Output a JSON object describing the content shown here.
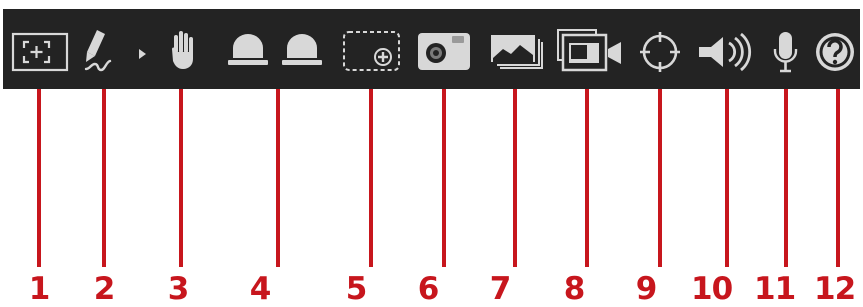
{
  "toolbar": {
    "background": "#232323",
    "icon_color": "#d8d8d8",
    "tools": [
      {
        "number": "1",
        "icon": "fullscreen-crosshair-icon"
      },
      {
        "number": "2",
        "icon": "pen-draw-icon",
        "has_dropdown": true
      },
      {
        "number": "3",
        "icon": "hand-icon"
      },
      {
        "number": "4",
        "icon": "alarm-light-icon",
        "count": 2
      },
      {
        "number": "5",
        "icon": "region-add-icon"
      },
      {
        "number": "6",
        "icon": "camera-icon"
      },
      {
        "number": "7",
        "icon": "gallery-icon"
      },
      {
        "number": "8",
        "icon": "video-record-icon"
      },
      {
        "number": "9",
        "icon": "target-crosshair-icon"
      },
      {
        "number": "10",
        "icon": "speaker-icon"
      },
      {
        "number": "11",
        "icon": "microphone-icon"
      },
      {
        "number": "12",
        "icon": "help-icon"
      }
    ]
  },
  "callout": {
    "color": "#c7161d"
  }
}
